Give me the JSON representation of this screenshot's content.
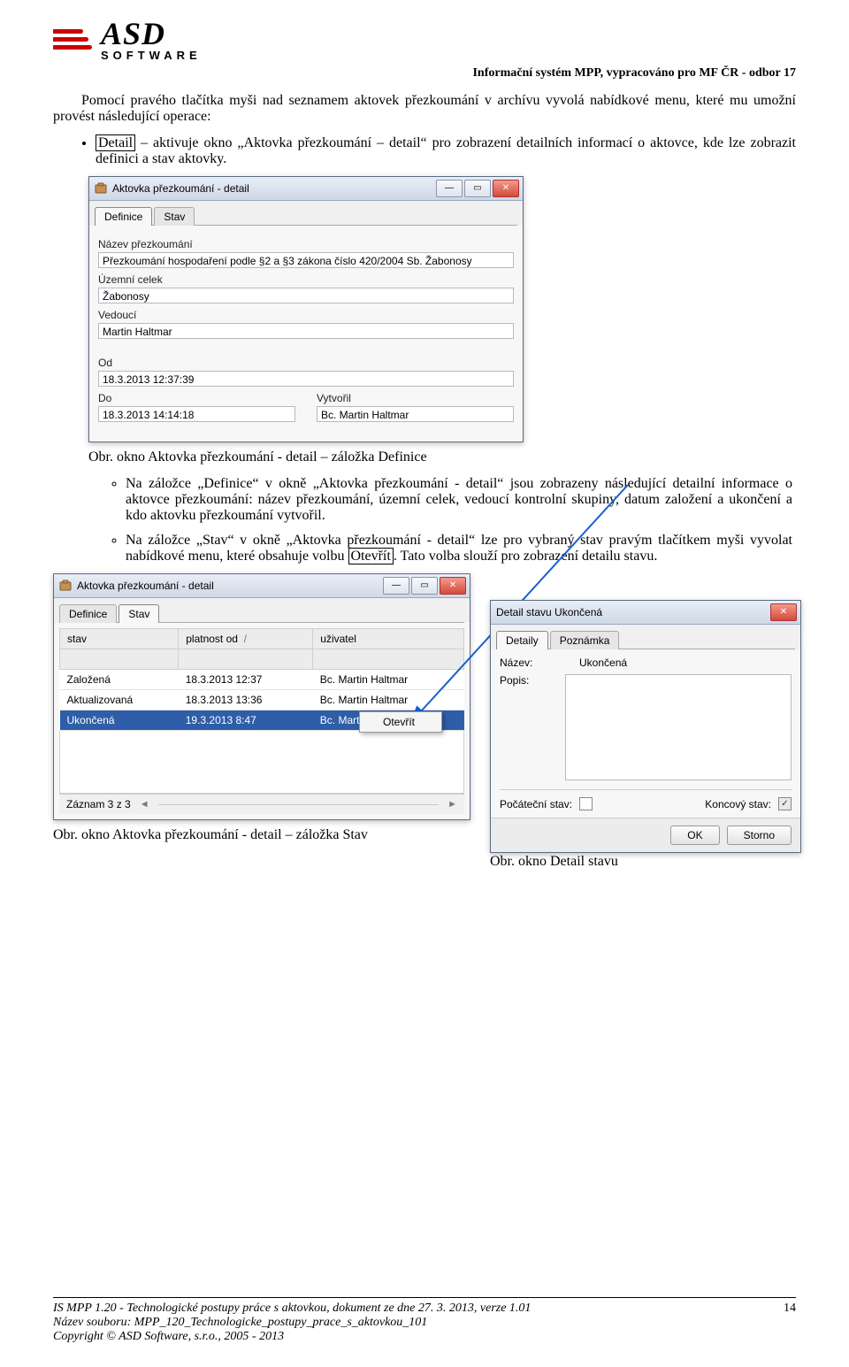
{
  "header": {
    "logo_main": "ASD",
    "logo_sub": "SOFTWARE",
    "right": "Informační systém MPP, vypracováno pro MF ČR - odbor 17"
  },
  "body": {
    "p1": "Pomocí pravého tlačítka myši nad seznamem aktovek přezkoumání v archívu vyvolá nabídkové menu, které mu umožní provést následující operace:",
    "b1_pre": "Detail",
    "b1_rest": " – aktivuje okno „Aktovka přezkoumání – detail“ pro zobrazení detailních informací o aktovce, kde lze zobrazit definici a stav aktovky.",
    "cap1": "Obr. okno Aktovka přezkoumání - detail – záložka Definice",
    "sub1": "Na záložce „Definice“ v okně „Aktovka přezkoumání - detail“ jsou zobrazeny následující detailní informace o aktovce přezkoumání: název přezkoumání, územní celek, vedoucí kontrolní skupiny, datum založení a ukončení a kdo aktovku přezkoumání vytvořil.",
    "sub2_a": "Na záložce „Stav“ v okně „Aktovka přezkoumání - detail“ lze pro vybraný stav pravým tlačítkem myši vyvolat nabídkové menu, které obsahuje volbu ",
    "sub2_boxed": "Otevřít",
    "sub2_b": ". Tato volba slouží pro zobrazení detailu stavu.",
    "cap2": "Obr. okno Aktovka přezkoumání - detail – záložka Stav",
    "cap3": "Obr. okno Detail stavu"
  },
  "win1": {
    "title": "Aktovka přezkoumání - detail",
    "tabs": {
      "definice": "Definice",
      "stav": "Stav"
    },
    "labels": {
      "nazev": "Název přezkoumání",
      "uzemni": "Územní celek",
      "vedouci": "Vedoucí",
      "od": "Od",
      "do": "Do",
      "vytvoril": "Vytvořil"
    },
    "values": {
      "nazev": "Přezkoumání hospodaření podle §2 a §3 zákona číslo 420/2004 Sb. Žabonosy",
      "uzemni": "Žabonosy",
      "vedouci": "Martin Haltmar",
      "od": "18.3.2013 12:37:39",
      "do": "18.3.2013 14:14:18",
      "vytvoril": "Bc. Martin Haltmar"
    }
  },
  "win2": {
    "title": "Aktovka přezkoumání - detail",
    "tabs": {
      "definice": "Definice",
      "stav": "Stav"
    },
    "cols": {
      "stav": "stav",
      "platnost": "platnost od",
      "sort": "/",
      "uzivatel": "uživatel"
    },
    "rows": [
      {
        "stav": "Založená",
        "platnost": "18.3.2013 12:37",
        "uzivatel": "Bc. Martin Haltmar"
      },
      {
        "stav": "Aktualizovaná",
        "platnost": "18.3.2013 13:36",
        "uzivatel": "Bc. Martin Haltmar"
      },
      {
        "stav": "Ukončená",
        "platnost": "19.3.2013 8:47",
        "uzivatel": "Bc. Martin Haltmar"
      }
    ],
    "status": "Záznam 3 z 3",
    "context_item": "Otevřít"
  },
  "win3": {
    "title": "Detail stavu Ukončená",
    "tabs": {
      "detaily": "Detaily",
      "poznamka": "Poznámka"
    },
    "labels": {
      "nazev": "Název:",
      "popis": "Popis:",
      "poc": "Počáteční stav:",
      "konc": "Koncový stav:"
    },
    "values": {
      "nazev": "Ukončená"
    },
    "buttons": {
      "ok": "OK",
      "storno": "Storno"
    }
  },
  "footer": {
    "l1": "IS MPP 1.20 - Technologické postupy práce s aktovkou, dokument ze dne 27. 3. 2013, verze 1.01",
    "l2": "Název souboru: MPP_120_Technologicke_postupy_prace_s_aktovkou_101",
    "l3": "Copyright © ASD Software, s.r.o., 2005 - 2013",
    "page": "14"
  }
}
